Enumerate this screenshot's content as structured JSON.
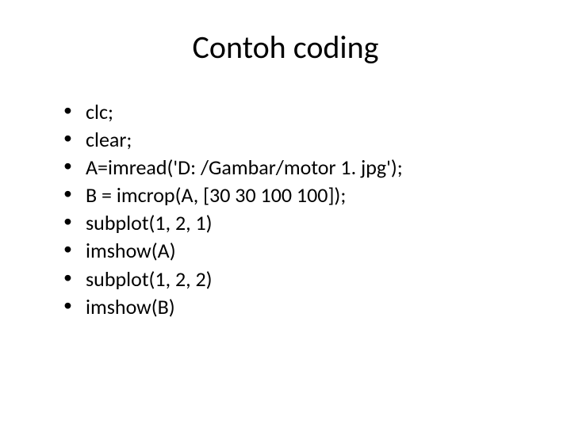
{
  "slide": {
    "title": "Contoh coding",
    "items": [
      "clc;",
      "clear;",
      "A=imread('D: /Gambar/motor 1. jpg');",
      "B = imcrop(A, [30 30 100 100]);",
      "subplot(1, 2, 1)",
      "imshow(A)",
      "subplot(1, 2, 2)",
      "imshow(B)"
    ]
  }
}
